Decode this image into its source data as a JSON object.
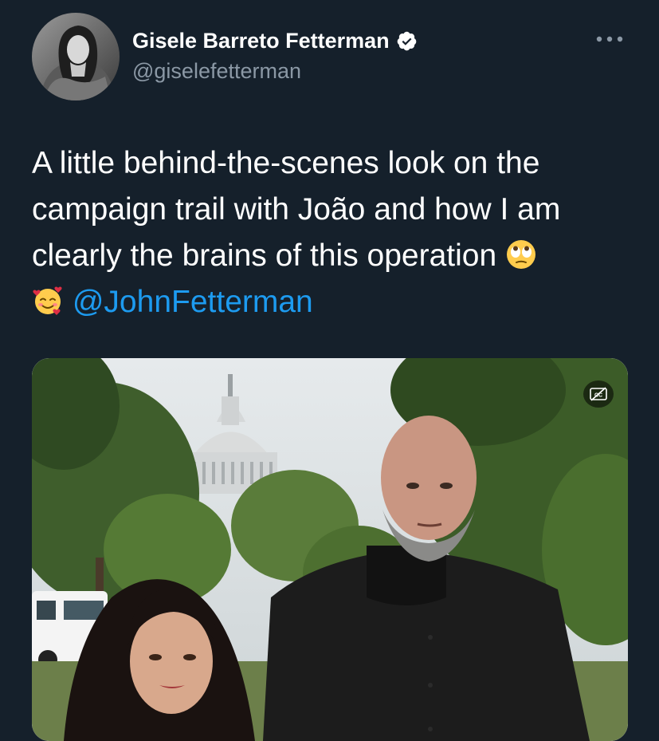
{
  "author": {
    "display_name": "Gisele Barreto Fetterman",
    "handle": "@giselefetterman",
    "verified": true,
    "avatar_icon": "profile-photo"
  },
  "tweet": {
    "line1": "A little behind-the-scenes look on the",
    "line2": "campaign trail with João and how I am",
    "line3": "clearly the brains of this operation",
    "emoji_eye_roll": "face-with-rolling-eyes-icon",
    "emoji_hearts": "smiling-face-with-hearts-icon",
    "mention": "@JohnFetterman"
  },
  "media": {
    "type": "video",
    "caption_control_icon": "closed-captions-off-icon"
  },
  "colors": {
    "background": "#15202b",
    "primary_text": "#ffffff",
    "secondary_text": "#8b98a5",
    "link": "#1d9bf0",
    "verified_badge": "#ffffff"
  },
  "more_icon": "more-options-icon"
}
